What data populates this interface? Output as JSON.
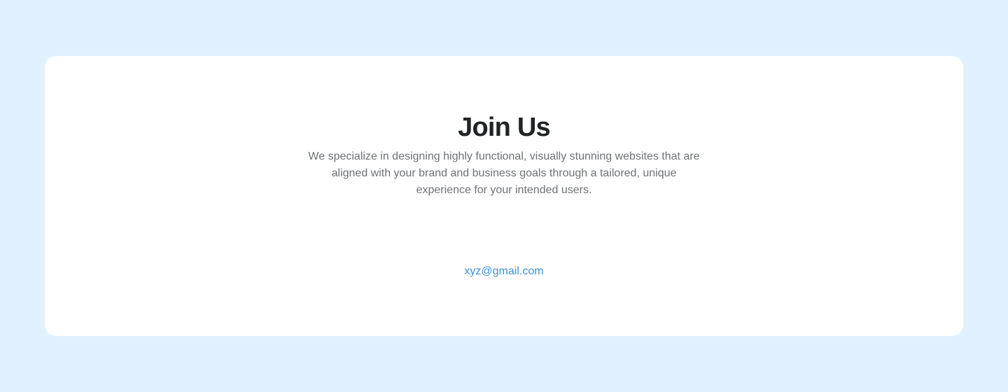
{
  "join": {
    "title": "Join Us",
    "description": "We specialize in designing highly functional, visually stunning websites that are aligned with your brand and business goals through a tailored, unique experience for your intended users.",
    "email": "xyz@gmail.com"
  },
  "colors": {
    "page_background": "#e0f0fe",
    "card_background": "#ffffff",
    "title": "#222324",
    "body_text": "#6f7175",
    "link": "#3a8fd9"
  }
}
